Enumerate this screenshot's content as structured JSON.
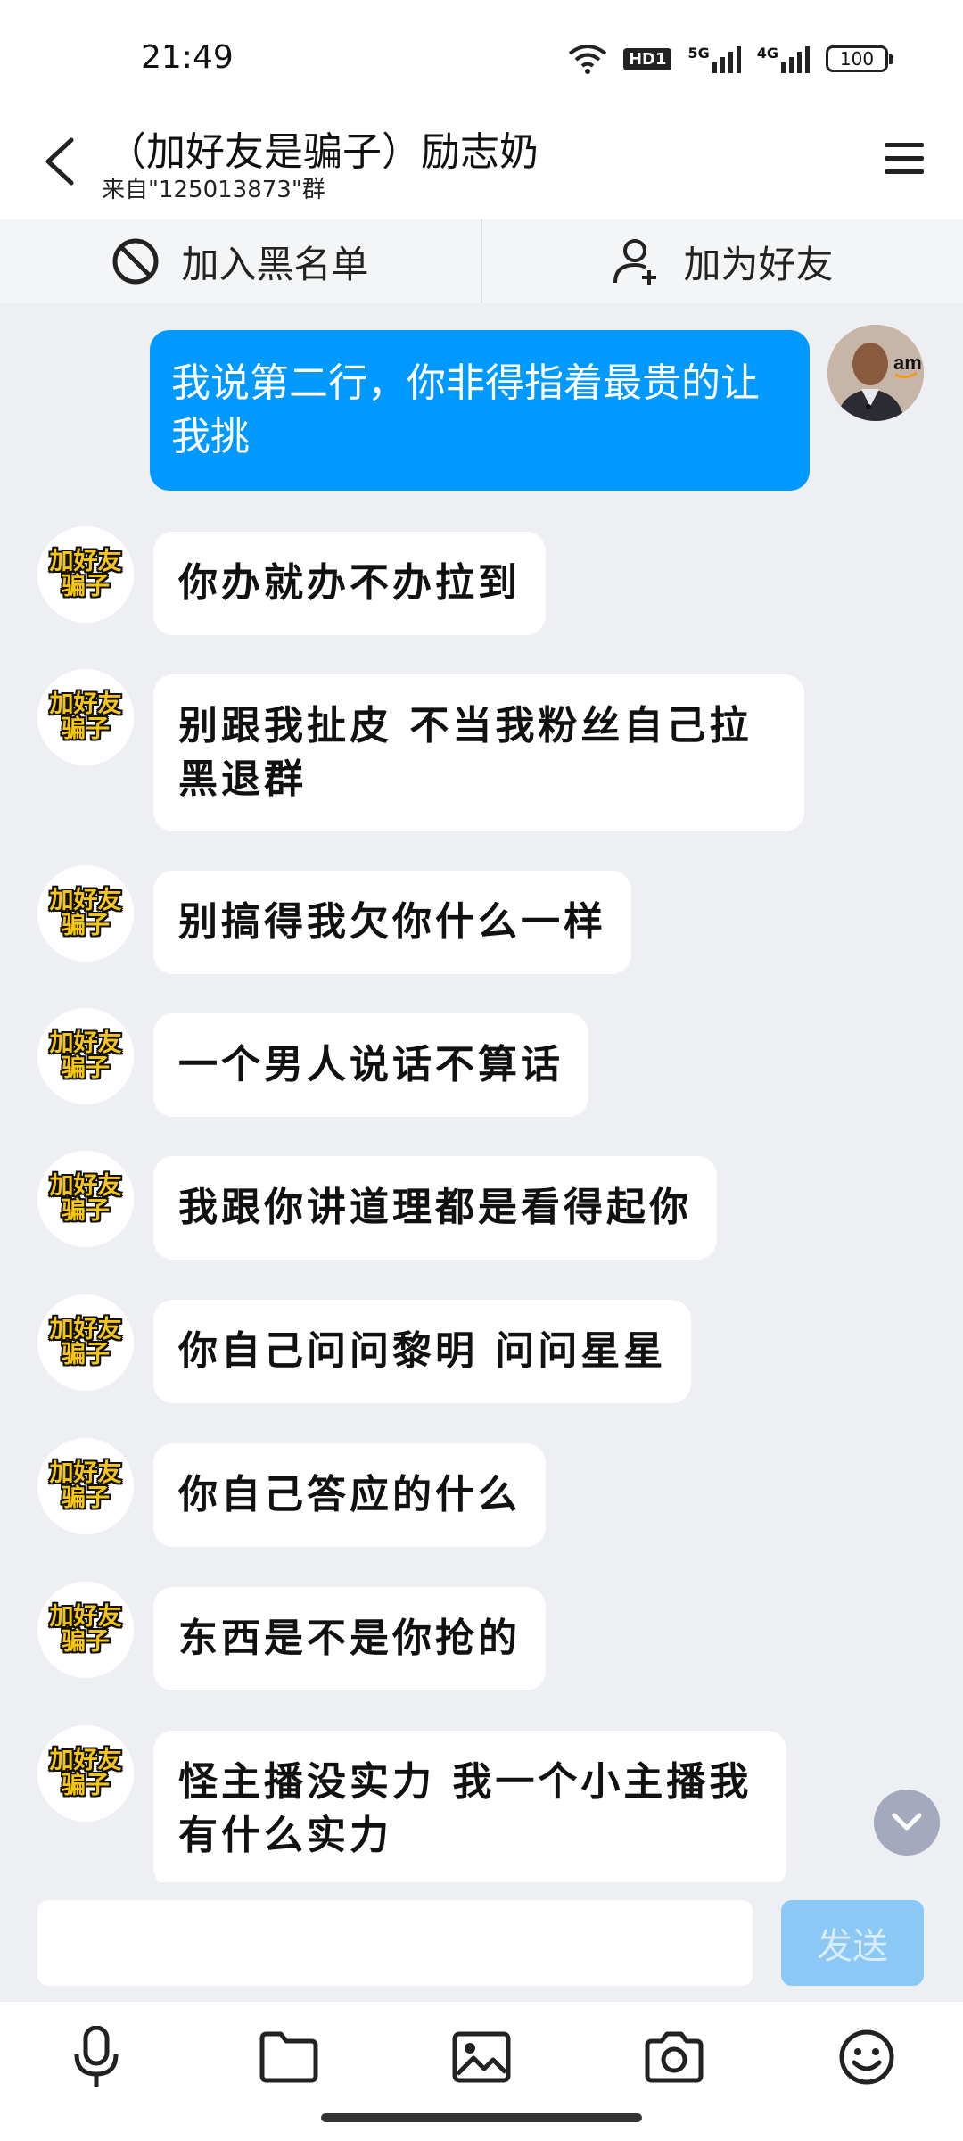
{
  "status": {
    "time": "21:49",
    "hd_badge": "HD1",
    "net1": "5G",
    "net2": "4G",
    "battery": "100"
  },
  "header": {
    "title": "（加好友是骗子）励志奶",
    "subtitle": "来自\"125013873\"群"
  },
  "actions": {
    "blacklist": "加入黑名单",
    "add_friend": "加为好友"
  },
  "self_avatar_text": "am",
  "other_avatar_text": [
    "加好友",
    "骗子"
  ],
  "messages": [
    {
      "from": "self",
      "text": "我说第二行，你非得指着最贵的让我挑"
    },
    {
      "from": "other",
      "text": "你办就办不办拉到"
    },
    {
      "from": "other",
      "text": "别跟我扯皮  不当我粉丝自己拉黑退群"
    },
    {
      "from": "other",
      "text": "别搞得我欠你什么一样"
    },
    {
      "from": "other",
      "text": "一个男人说话不算话"
    },
    {
      "from": "other",
      "text": "我跟你讲道理都是看得起你"
    },
    {
      "from": "other",
      "text": "你自己问问黎明  问问星星"
    },
    {
      "from": "other",
      "text": "你自己答应的什么"
    },
    {
      "from": "other",
      "text": "东西是不是你抢的"
    },
    {
      "from": "other",
      "text": "怪主播没实力 我一个小主播我有什么实力"
    }
  ],
  "input": {
    "placeholder": "",
    "send_label": "发送"
  },
  "toolbar": {
    "icons": [
      "microphone-icon",
      "folder-icon",
      "image-icon",
      "camera-icon",
      "emoji-icon"
    ]
  },
  "colors": {
    "self_bubble": "#0099ff",
    "other_bubble": "#ffffff",
    "send_button": "#8cc8f5",
    "background": "#eeeff3"
  }
}
